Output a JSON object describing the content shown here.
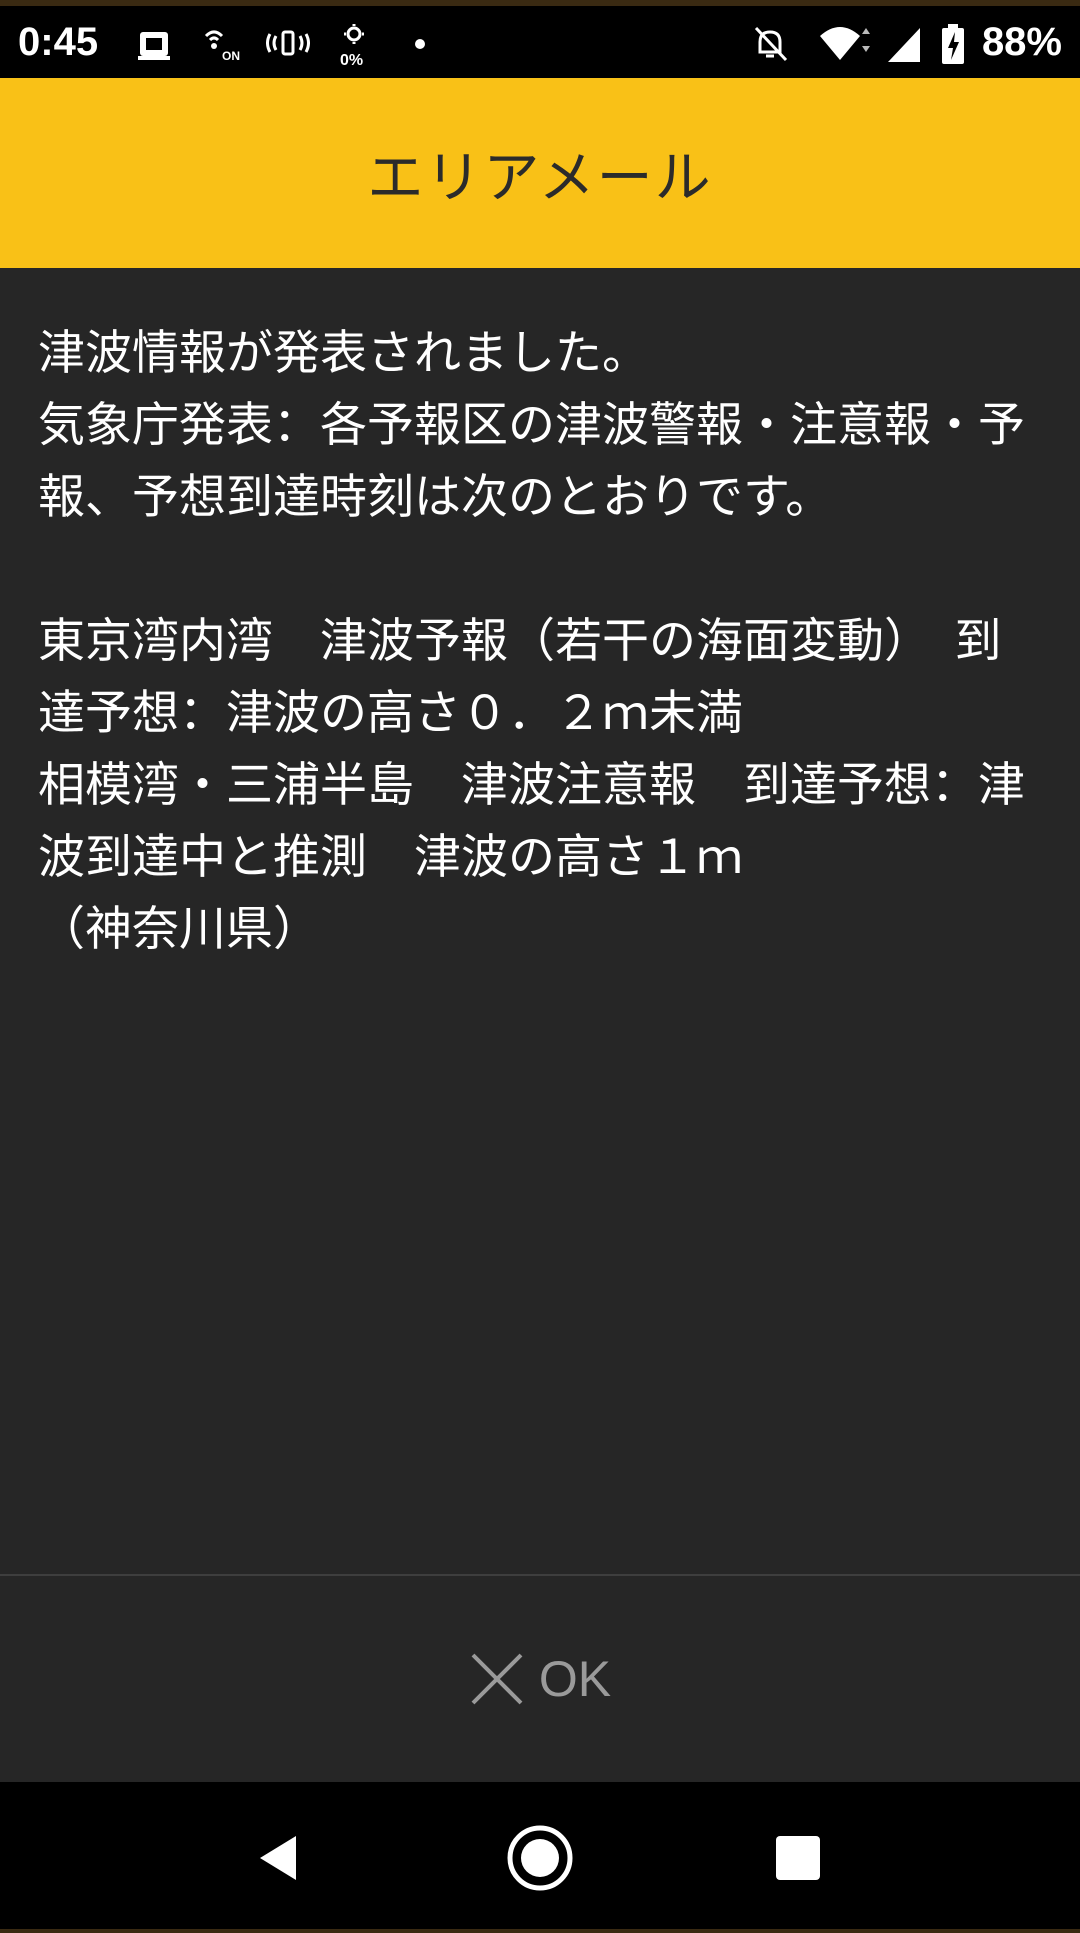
{
  "status_bar": {
    "time": "0:45",
    "battery_percent": "88%",
    "brightness_percent": "0%",
    "icons": [
      "sim-card-icon",
      "nfc-on-icon",
      "vibrate-icon",
      "brightness-icon",
      "dot-icon",
      "notifications-off-icon",
      "wifi-icon",
      "signal-icon",
      "battery-charging-icon"
    ]
  },
  "header": {
    "title": "エリアメール"
  },
  "message": {
    "text": "津波情報が発表されました。\n気象庁発表：各予報区の津波警報・注意報・予報、予想到達時刻は次のとおりです。\n\n東京湾内湾　津波予報（若干の海面変動）　到達予想：津波の高さ０．２ｍ未満\n相模湾・三浦半島　津波注意報　到達予想：津波到達中と推測　津波の高さ１ｍ\n（神奈川県）"
  },
  "actions": {
    "ok_label": "OK"
  },
  "navigation": {
    "back": "back-icon",
    "home": "home-icon",
    "recents": "recents-icon"
  },
  "colors": {
    "header_bg": "#f9c117",
    "body_bg": "#262626",
    "text": "#ffffff",
    "ok_text": "#9a9a9a"
  }
}
